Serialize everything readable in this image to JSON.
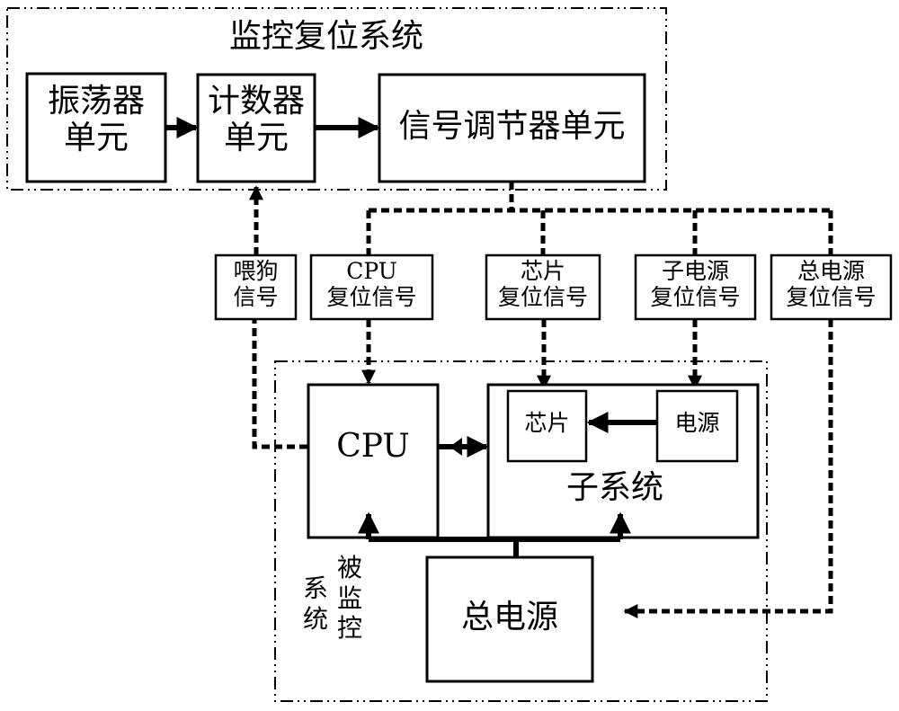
{
  "diagram": {
    "monitor_system": {
      "title": "监控复位系统",
      "oscillator": {
        "line1": "振荡器",
        "line2": "单元"
      },
      "counter": {
        "line1": "计数器",
        "line2": "单元"
      },
      "regulator": {
        "label": "信号调节器单元"
      }
    },
    "signals": {
      "watchdog": {
        "line1": "喂狗",
        "line2": "信号"
      },
      "cpu_reset": {
        "line1": "CPU",
        "line2": "复位信号"
      },
      "chip_reset": {
        "line1": "芯片",
        "line2": "复位信号"
      },
      "sub_power_reset": {
        "line1": "子电源",
        "line2": "复位信号"
      },
      "main_power_reset": {
        "line1": "总电源",
        "line2": "复位信号"
      }
    },
    "monitored_system": {
      "title_col1": "被监控",
      "title_col2": "系统",
      "cpu": "CPU",
      "subsystem": {
        "title": "子系统",
        "chip": "芯片",
        "power": "电源"
      },
      "main_power": "总电源"
    }
  }
}
